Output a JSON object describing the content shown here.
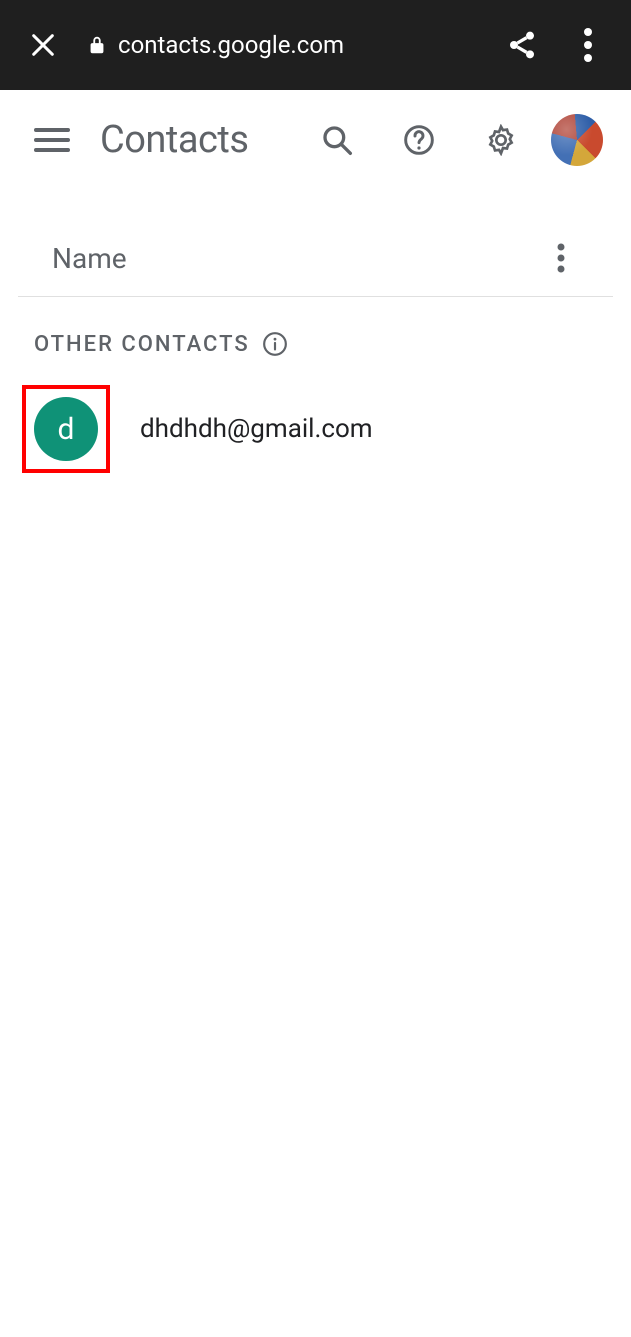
{
  "browser": {
    "url": "contacts.google.com"
  },
  "header": {
    "title": "Contacts"
  },
  "columns": {
    "name_label": "Name"
  },
  "section": {
    "label": "OTHER CONTACTS"
  },
  "contacts": [
    {
      "avatar_letter": "d",
      "avatar_color": "#0f9277",
      "email": "dhdhdh@gmail.com",
      "highlighted": true
    }
  ]
}
